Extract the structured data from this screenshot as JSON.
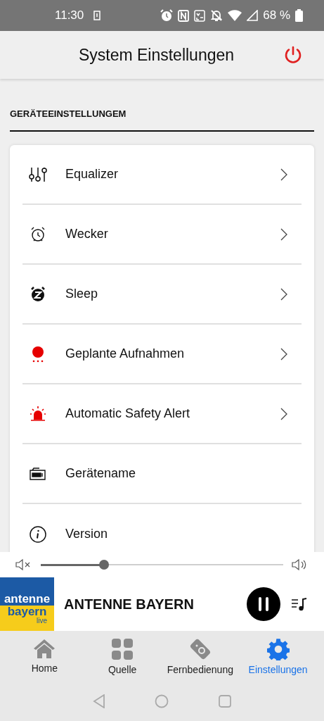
{
  "status_bar": {
    "time": "11:30",
    "battery": "68 %"
  },
  "header": {
    "title": "System Einstellungen"
  },
  "section": {
    "title": "GERÄTEEINSTELLUNGEM"
  },
  "items": [
    {
      "kind": "equalizer",
      "label": "Equalizer",
      "chevron": true
    },
    {
      "kind": "alarm",
      "label": "Wecker",
      "chevron": true
    },
    {
      "kind": "sleep",
      "label": "Sleep",
      "chevron": true
    },
    {
      "kind": "record",
      "label": "Geplante Aufnahmen",
      "chevron": true
    },
    {
      "kind": "siren",
      "label": "Automatic Safety Alert",
      "chevron": true
    },
    {
      "kind": "device",
      "label": "Gerätename",
      "chevron": false
    },
    {
      "kind": "info",
      "label": "Version",
      "chevron": false
    }
  ],
  "volume": {
    "level": 0.26
  },
  "player": {
    "logo": [
      "antenne",
      "bayern",
      "live"
    ],
    "station": "ANTENNE BAYERN",
    "playing": true
  },
  "tabs": [
    {
      "kind": "home",
      "label": "Home",
      "selected": false
    },
    {
      "kind": "grid",
      "label": "Quelle",
      "selected": false
    },
    {
      "kind": "remote",
      "label": "Fernbedienung",
      "selected": false
    },
    {
      "kind": "gear",
      "label": "Einstellungen",
      "selected": true
    }
  ]
}
